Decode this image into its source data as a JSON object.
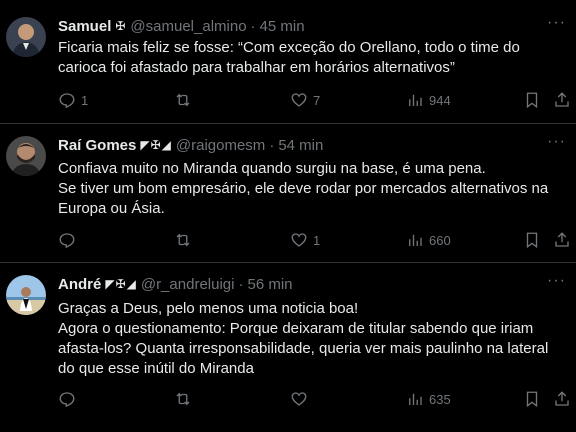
{
  "tweets": [
    {
      "name": "Samuel",
      "badges": "✠",
      "handle": "@samuel_almino",
      "time": "45 min",
      "lines": [
        "Ficaria mais feliz se fosse: “Com exceção do Orellano, todo o time do",
        "carioca foi afastado para trabalhar em horários alternativos”"
      ],
      "replies": "1",
      "retweets": "",
      "likes": "7",
      "views": "944"
    },
    {
      "name": "Raí Gomes",
      "badges": "◤✠◢",
      "handle": "@raigomesm",
      "time": "54 min",
      "lines": [
        "Confiava muito no Miranda quando surgiu na base, é uma pena.",
        "Se tiver um bom empresário, ele deve rodar por mercados alternativos na",
        "Europa ou Ásia."
      ],
      "replies": "",
      "retweets": "",
      "likes": "1",
      "views": "660"
    },
    {
      "name": "André",
      "badges": "◤✠◢",
      "handle": "@r_andreluigi",
      "time": "56 min",
      "lines": [
        "Graças a Deus, pelo menos uma noticia boa!",
        "Agora o questionamento: Porque deixaram de titular sabendo que iriam",
        "afasta-los? Quanta irresponsabilidade, queria ver mais paulinho na lateral",
        "do que esse inútil do Miranda"
      ],
      "replies": "",
      "retweets": "",
      "likes": "",
      "views": "635"
    }
  ],
  "separator": "·",
  "more_label": "···",
  "colors": {
    "background": "#000000",
    "text": "#e7e9ea",
    "muted": "#71767b",
    "border": "#2f3336"
  },
  "icons": [
    "reply-icon",
    "retweet-icon",
    "like-icon",
    "views-icon",
    "bookmark-icon",
    "share-icon"
  ]
}
